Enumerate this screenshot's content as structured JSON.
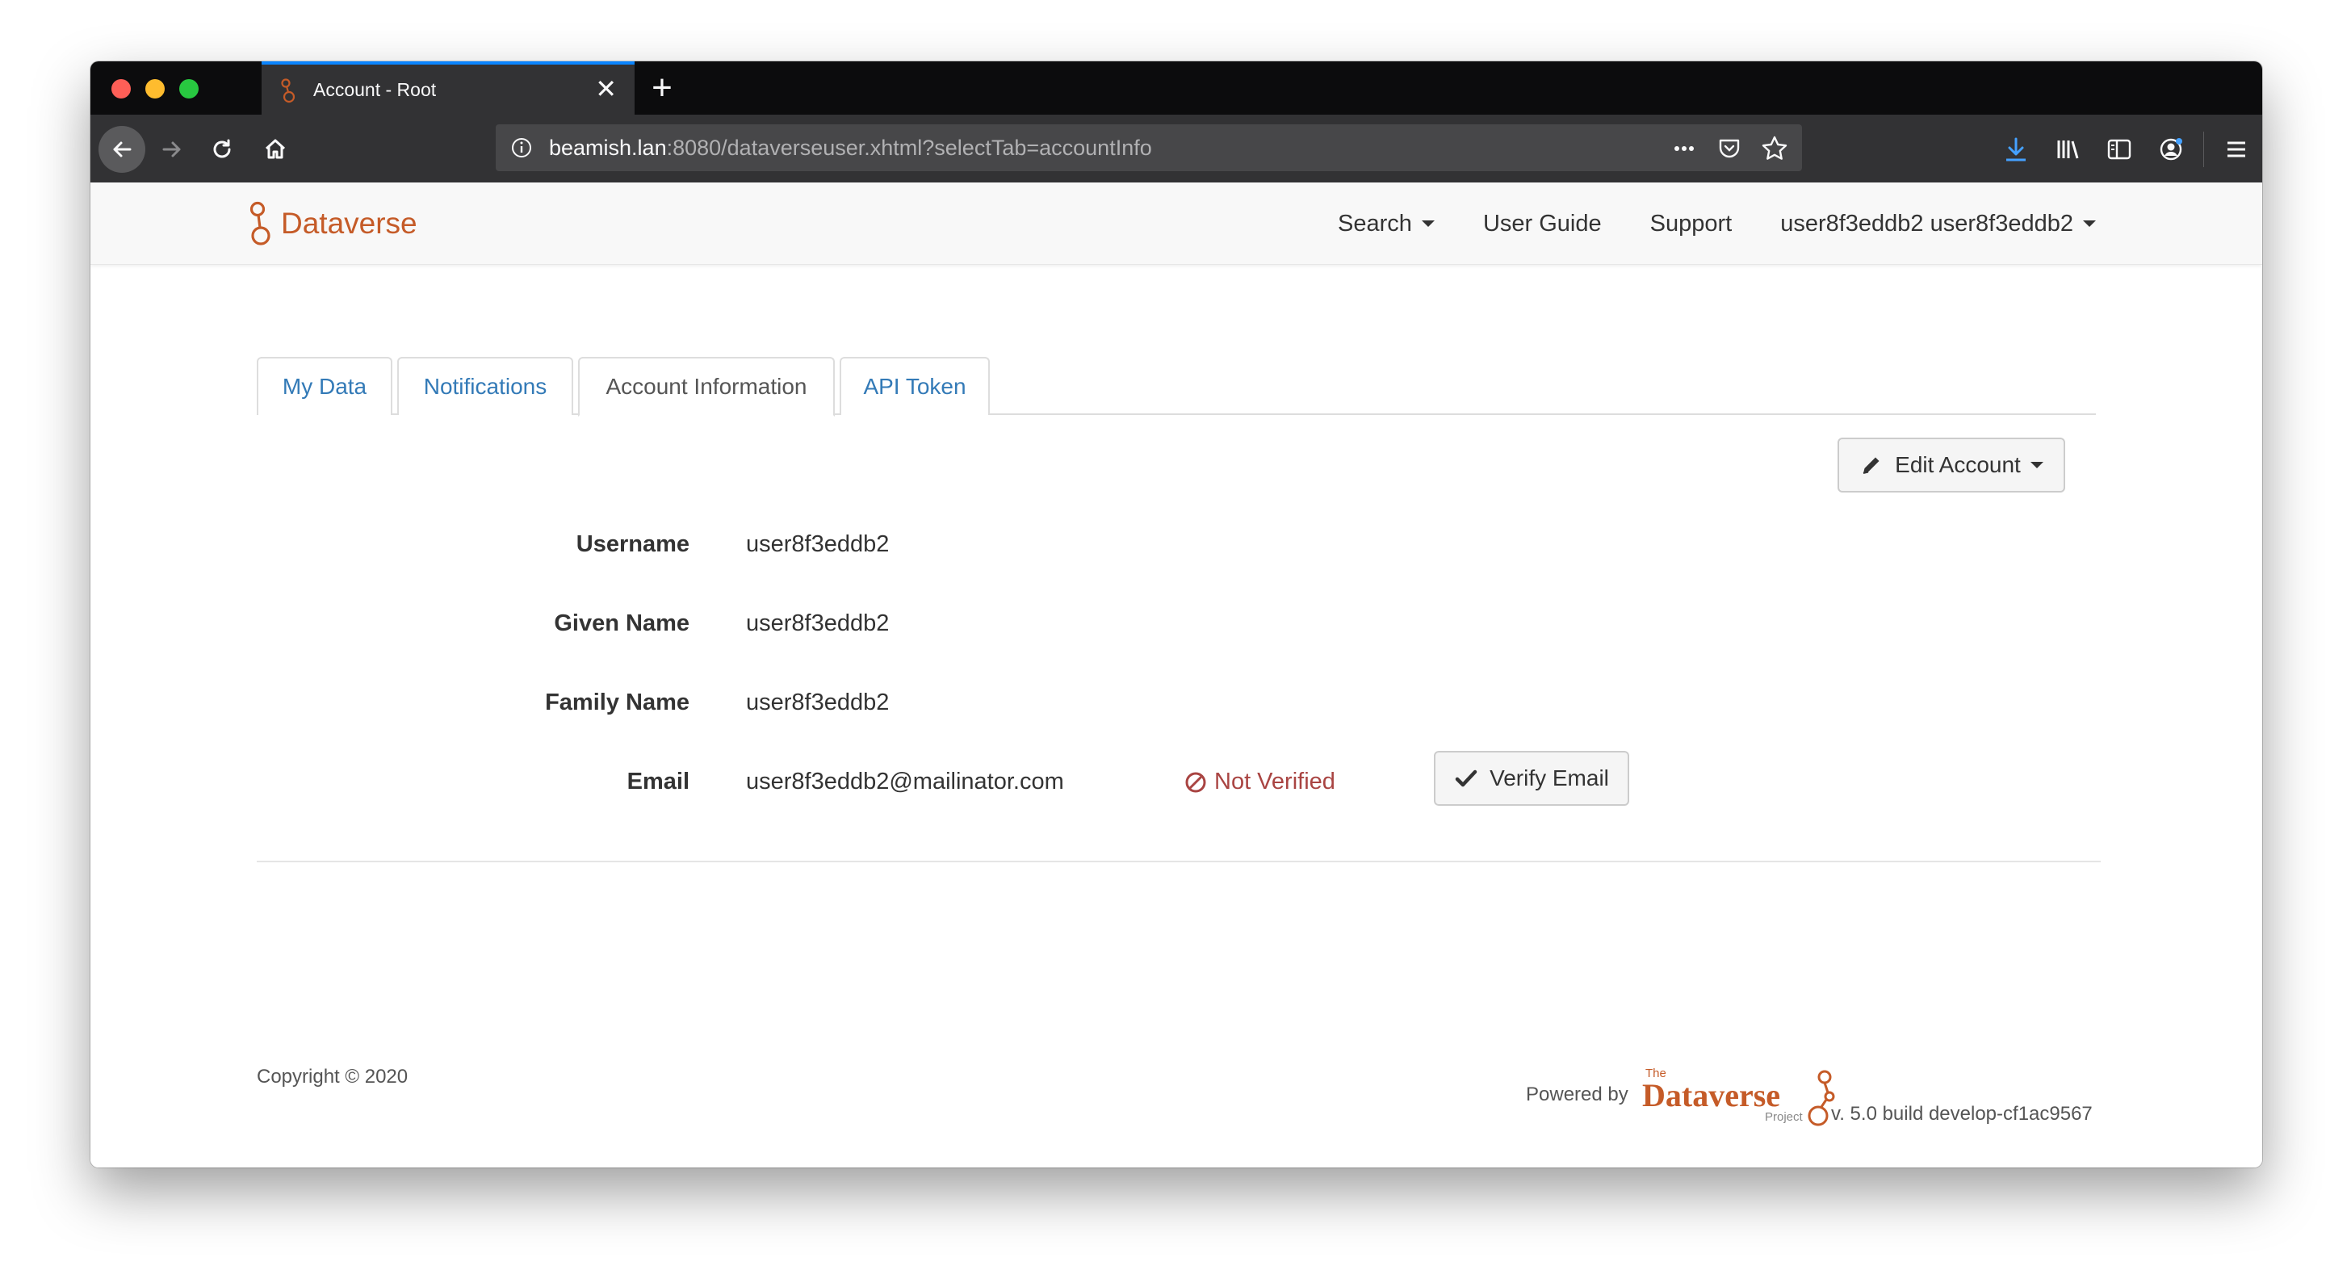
{
  "browser": {
    "tab_title": "Account - Root",
    "url_host": "beamish.lan",
    "url_rest": ":8080/dataverseuser.xhtml?selectTab=accountInfo",
    "accent": "#0a84ff"
  },
  "navbar": {
    "brand": "Dataverse",
    "brand_color": "#c55b28",
    "search": "Search",
    "user_guide": "User Guide",
    "support": "Support",
    "user_menu": "user8f3eddb2 user8f3eddb2"
  },
  "tabs": {
    "my_data": "My Data",
    "notifications": "Notifications",
    "account_information": "Account Information",
    "api_token": "API Token"
  },
  "actions": {
    "edit_account": "Edit Account",
    "verify_email": "Verify Email"
  },
  "account": {
    "username_label": "Username",
    "username": "user8f3eddb2",
    "given_name_label": "Given Name",
    "given_name": "user8f3eddb2",
    "family_name_label": "Family Name",
    "family_name": "user8f3eddb2",
    "email_label": "Email",
    "email": "user8f3eddb2@mailinator.com",
    "email_status": "Not Verified",
    "email_status_color": "#a94442"
  },
  "footer": {
    "copyright": "Copyright © 2020",
    "powered_by": "Powered by",
    "logo_the": "The",
    "logo_name": "Dataverse",
    "logo_project": "Project",
    "version": "v. 5.0 build develop-cf1ac9567"
  }
}
